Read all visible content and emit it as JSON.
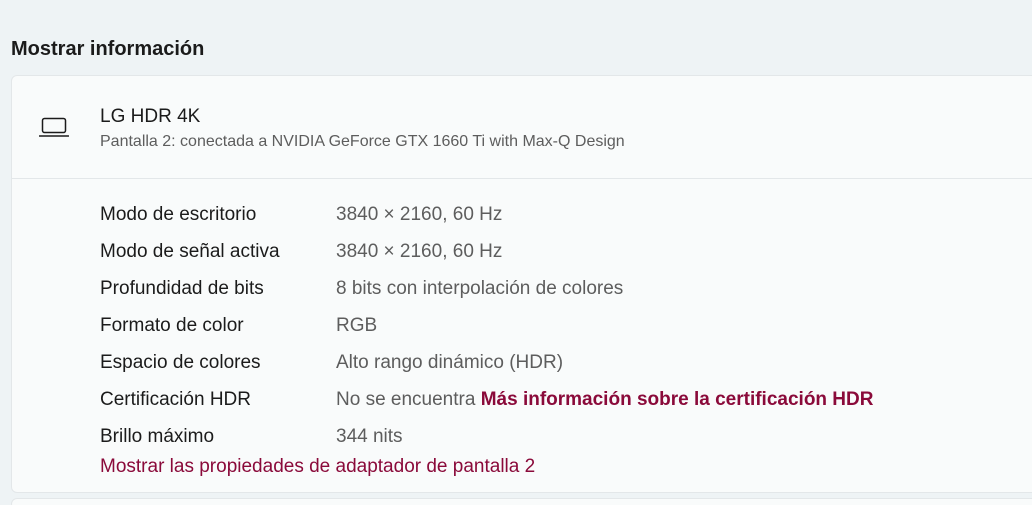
{
  "section": {
    "title": "Mostrar información"
  },
  "display": {
    "icon": "laptop-icon",
    "name": "LG HDR 4K",
    "subtitle": "Pantalla 2: conectada a NVIDIA GeForce GTX 1660 Ti with Max-Q Design"
  },
  "properties": [
    {
      "label": "Modo de escritorio",
      "value": "3840 × 2160, 60 Hz"
    },
    {
      "label": "Modo de señal activa",
      "value": "3840 × 2160, 60 Hz"
    },
    {
      "label": "Profundidad de bits",
      "value": "8 bits con interpolación de colores"
    },
    {
      "label": "Formato de color",
      "value": "RGB"
    },
    {
      "label": "Espacio de colores",
      "value": "Alto rango dinámico (HDR)"
    },
    {
      "label": "Certificación HDR",
      "value": "No se encuentra",
      "link": "Más información sobre la certificación HDR"
    },
    {
      "label": "Brillo máximo",
      "value": "344 nits"
    }
  ],
  "adapter_link": "Mostrar las propiedades de adaptador de pantalla 2",
  "colors": {
    "accent": "#8a0a3a",
    "secondary_text": "#5d5d5d",
    "background": "#eef3f5",
    "card": "#f9fbfb"
  }
}
